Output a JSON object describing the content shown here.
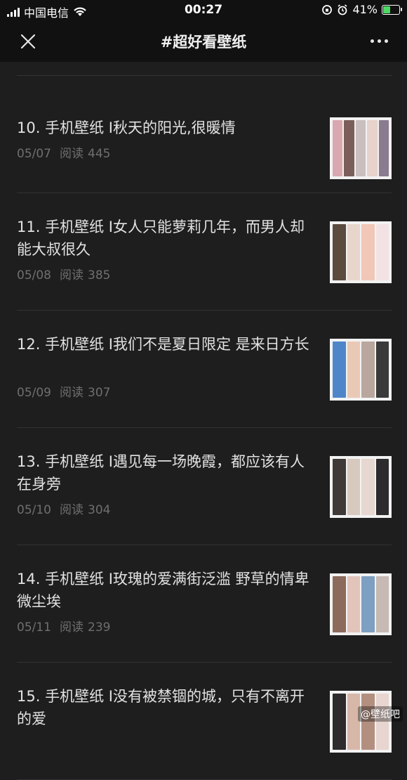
{
  "status_bar": {
    "carrier": "中国电信",
    "time": "00:27",
    "battery": "41%",
    "battery_level": 0.41
  },
  "nav": {
    "title": "#超好看壁纸"
  },
  "articles": [
    {
      "title": "10. 手机壁纸 I秋天的阳光,很暖情",
      "date": "05/07",
      "read_label": "阅读",
      "reads": "445",
      "thumb_colors": [
        "#d9a7b0",
        "#7b5e5a",
        "#c9bfbf",
        "#e7d3cc",
        "#8a7b8f"
      ]
    },
    {
      "title": "11. 手机壁纸 I女人只能萝莉几年，而男人却能大叔很久",
      "date": "05/08",
      "read_label": "阅读",
      "reads": "385",
      "thumb_colors": [
        "#5b4c3f",
        "#e8d6cc",
        "#f1c7b8",
        "#f3e2e4"
      ]
    },
    {
      "title": "12. 手机壁纸 I我们不是夏日限定 是来日方长",
      "date": "05/09",
      "read_label": "阅读",
      "reads": "307",
      "thumb_colors": [
        "#4f86c9",
        "#e9c9b6",
        "#b9a79e",
        "#3a3a3a"
      ]
    },
    {
      "title": "13. 手机壁纸 I遇见每一场晚霞，都应该有人在身旁",
      "date": "05/10",
      "read_label": "阅读",
      "reads": "304",
      "thumb_colors": [
        "#3f3a37",
        "#d8c9bf",
        "#e6d8d0",
        "#2d2b2e"
      ]
    },
    {
      "title": "14. 手机壁纸 I玫瑰的爱满街泛滥 野草的情卑微尘埃",
      "date": "05/11",
      "read_label": "阅读",
      "reads": "239",
      "thumb_colors": [
        "#8c6b5c",
        "#e3c4ba",
        "#7d9fc1",
        "#c7b9b3"
      ]
    },
    {
      "title": "15. 手机壁纸 I没有被禁锢的城，只有不离开的爱",
      "date": "",
      "read_label": "",
      "reads": "",
      "thumb_colors": [
        "#2d2b2e",
        "#d7b8a8",
        "#b38f80",
        "#e8d5cf"
      ]
    }
  ],
  "watermark": "@壁纸吧"
}
